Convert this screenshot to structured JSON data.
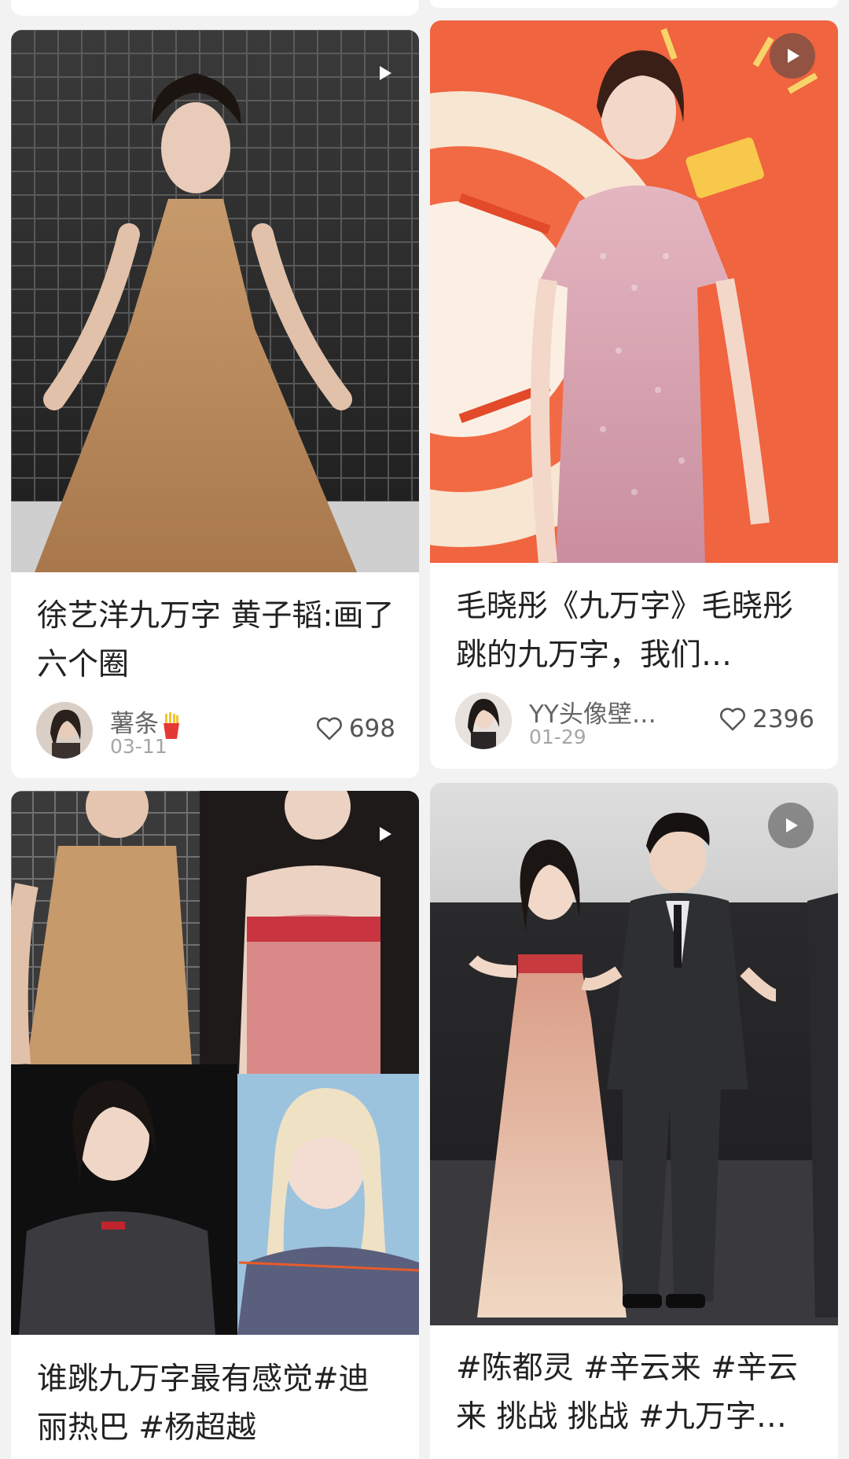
{
  "cards": [
    {
      "title": "徐艺洋九万字 黄子韬:画了六个圈",
      "author": "薯条",
      "date": "03-11",
      "likes": "698",
      "has_video": true
    },
    {
      "title": "毛晓彤《九万字》毛晓彤跳的九万字，我们…",
      "author": "YY头像壁…",
      "date": "01-29",
      "likes": "2396",
      "has_video": true
    },
    {
      "title": "谁跳九万字最有感觉#迪丽热巴 #杨超越",
      "has_video": true
    },
    {
      "title": "#陈都灵 #辛云来 #辛云来 挑战 挑战 #九万字…",
      "has_video": true
    }
  ],
  "icons": {
    "play": "play-icon",
    "like": "heart-outline-icon",
    "emoji": "french-fries-emoji"
  },
  "colors": {
    "background": "#f2f2f2",
    "card": "#ffffff",
    "title_text": "#222222",
    "meta_text": "#666666"
  }
}
